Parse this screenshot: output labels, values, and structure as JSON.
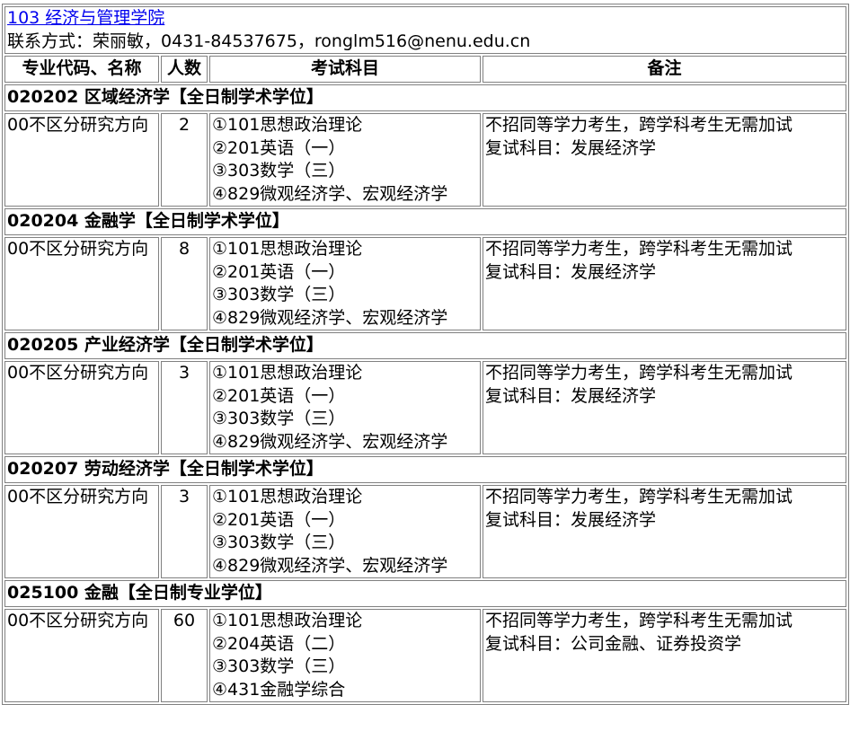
{
  "header": {
    "college_link": "103 经济与管理学院",
    "contact": "联系方式：荣丽敏，0431-84537675，ronglm516@nenu.edu.cn"
  },
  "columns": [
    "专业代码、名称",
    "人数",
    "考试科目",
    "备注"
  ],
  "majors": [
    {
      "title": "020202 区域经济学【全日制学术学位】",
      "direction": "00不区分研究方向",
      "count": "2",
      "subjects": [
        "①101思想政治理论",
        "②201英语（一）",
        "③303数学（三）",
        "④829微观经济学、宏观经济学"
      ],
      "notes": [
        "不招同等学力考生，跨学科考生无需加试",
        "复试科目：发展经济学"
      ]
    },
    {
      "title": "020204 金融学【全日制学术学位】",
      "direction": "00不区分研究方向",
      "count": "8",
      "subjects": [
        "①101思想政治理论",
        "②201英语（一）",
        "③303数学（三）",
        "④829微观经济学、宏观经济学"
      ],
      "notes": [
        "不招同等学力考生，跨学科考生无需加试",
        "复试科目：发展经济学"
      ]
    },
    {
      "title": "020205 产业经济学【全日制学术学位】",
      "direction": "00不区分研究方向",
      "count": "3",
      "subjects": [
        "①101思想政治理论",
        "②201英语（一）",
        "③303数学（三）",
        "④829微观经济学、宏观经济学"
      ],
      "notes": [
        "不招同等学力考生，跨学科考生无需加试",
        "复试科目：发展经济学"
      ]
    },
    {
      "title": "020207 劳动经济学【全日制学术学位】",
      "direction": "00不区分研究方向",
      "count": "3",
      "subjects": [
        "①101思想政治理论",
        "②201英语（一）",
        "③303数学（三）",
        "④829微观经济学、宏观经济学"
      ],
      "notes": [
        "不招同等学力考生，跨学科考生无需加试",
        "复试科目：发展经济学"
      ]
    },
    {
      "title": "025100 金融【全日制专业学位】",
      "direction": "00不区分研究方向",
      "count": "60",
      "subjects": [
        "①101思想政治理论",
        "②204英语（二）",
        "③303数学（三）",
        "④431金融学综合"
      ],
      "notes": [
        "不招同等学力考生，跨学科考生无需加试",
        "复试科目：公司金融、证券投资学"
      ]
    }
  ]
}
